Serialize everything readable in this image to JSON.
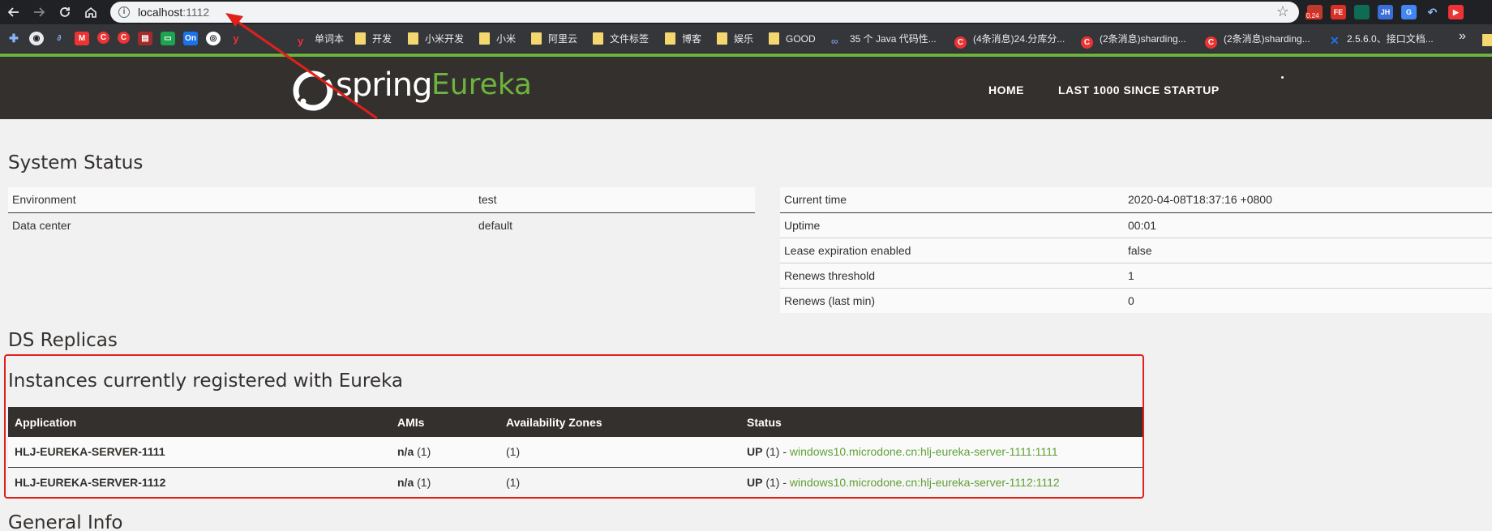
{
  "browser": {
    "url_host": "localhost",
    "url_port": ":1112",
    "extension_badge": "0.24"
  },
  "bookmarks": [
    {
      "label": "单词本",
      "icon": "youdao-icon"
    },
    {
      "label": "开发",
      "icon": "folder-icon"
    },
    {
      "label": "小米开发",
      "icon": "folder-icon"
    },
    {
      "label": "小米",
      "icon": "folder-icon"
    },
    {
      "label": "阿里云",
      "icon": "folder-icon"
    },
    {
      "label": "文件标签",
      "icon": "folder-icon"
    },
    {
      "label": "博客",
      "icon": "folder-icon"
    },
    {
      "label": "娱乐",
      "icon": "folder-icon"
    },
    {
      "label": "GOOD",
      "icon": "folder-icon"
    },
    {
      "label": "35 个 Java 代码性...",
      "icon": "link-icon"
    },
    {
      "label": "(4条消息)24.分库分...",
      "icon": "csdn-icon"
    },
    {
      "label": "(2条消息)sharding...",
      "icon": "csdn-icon"
    },
    {
      "label": "(2条消息)sharding...",
      "icon": "csdn-icon"
    },
    {
      "label": "2.5.6.0、接口文档...",
      "icon": "confluence-icon"
    }
  ],
  "header": {
    "logo_spring": "spring",
    "logo_eureka": "Eureka",
    "nav_home": "HOME",
    "nav_last": "LAST 1000 SINCE STARTUP",
    "brand_color": "#6db33f",
    "bar_color": "#34302d"
  },
  "system_status": {
    "title": "System Status",
    "env_rows": [
      {
        "label": "Environment",
        "value": "test"
      },
      {
        "label": "Data center",
        "value": "default"
      }
    ],
    "time_rows": [
      {
        "label": "Current time",
        "value": "2020-04-08T18:37:16 +0800"
      },
      {
        "label": "Uptime",
        "value": "00:01"
      },
      {
        "label": "Lease expiration enabled",
        "value": "false"
      },
      {
        "label": "Renews threshold",
        "value": "1"
      },
      {
        "label": "Renews (last min)",
        "value": "0"
      }
    ]
  },
  "ds_replicas": {
    "title": "DS Replicas"
  },
  "instances": {
    "title": "Instances currently registered with Eureka",
    "columns": [
      "Application",
      "AMIs",
      "Availability Zones",
      "Status"
    ],
    "rows": [
      {
        "application": "HLJ-EUREKA-SERVER-1111",
        "ami_value": "n/a",
        "ami_count": "(1)",
        "zones": "(1)",
        "status": "UP",
        "status_count": "(1) -",
        "link": "windows10.microdone.cn:hlj-eureka-server-1111:1111"
      },
      {
        "application": "HLJ-EUREKA-SERVER-1112",
        "ami_value": "n/a",
        "ami_count": "(1)",
        "zones": "(1)",
        "status": "UP",
        "status_count": "(1) -",
        "link": "windows10.microdone.cn:hlj-eureka-server-1112:1112"
      }
    ]
  },
  "general_info": {
    "title": "General Info"
  },
  "annotation_color": "#e0201b"
}
